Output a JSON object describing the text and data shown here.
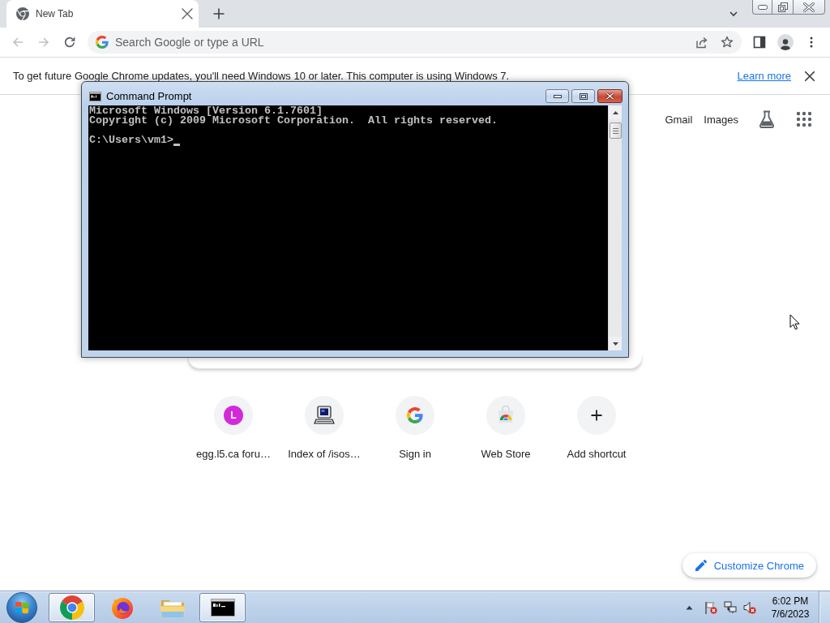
{
  "browser": {
    "tabs": [
      {
        "title": "New Tab",
        "selected": true
      }
    ],
    "toolbar": {
      "back": {
        "disabled": true
      },
      "forward": {
        "disabled": true
      },
      "omnibox": {
        "placeholder": "Search Google or type a URL"
      }
    },
    "infobar": {
      "message": "To get future Google Chrome updates, you'll need Windows 10 or later. This computer is using Windows 7.",
      "link": "Learn more"
    },
    "new_tab_page": {
      "header_links": [
        "Gmail",
        "Images"
      ],
      "shortcuts": [
        {
          "kind": "letter",
          "letter": "L",
          "color": "#d22ad9",
          "title": "egg.l5.ca foru…"
        },
        {
          "kind": "computer",
          "title": "Index of /isos…"
        },
        {
          "kind": "google",
          "title": "Sign in"
        },
        {
          "kind": "webstore",
          "title": "Web Store"
        },
        {
          "kind": "add",
          "title": "Add shortcut"
        }
      ],
      "customize_button": "Customize Chrome"
    }
  },
  "console_window": {
    "title": "Command Prompt",
    "lines": [
      "Microsoft Windows [Version 6.1.7601]",
      "Copyright (c) 2009 Microsoft Corporation.  All rights reserved."
    ],
    "prompt": "C:\\Users\\vm1>"
  },
  "taskbar": {
    "apps": [
      {
        "kind": "chrome",
        "running": true
      },
      {
        "kind": "firefox",
        "running": false
      },
      {
        "kind": "explorer",
        "running": false
      },
      {
        "kind": "console",
        "running": true
      }
    ],
    "clock": {
      "time": "6:02 PM",
      "date": "7/6/2023"
    }
  }
}
